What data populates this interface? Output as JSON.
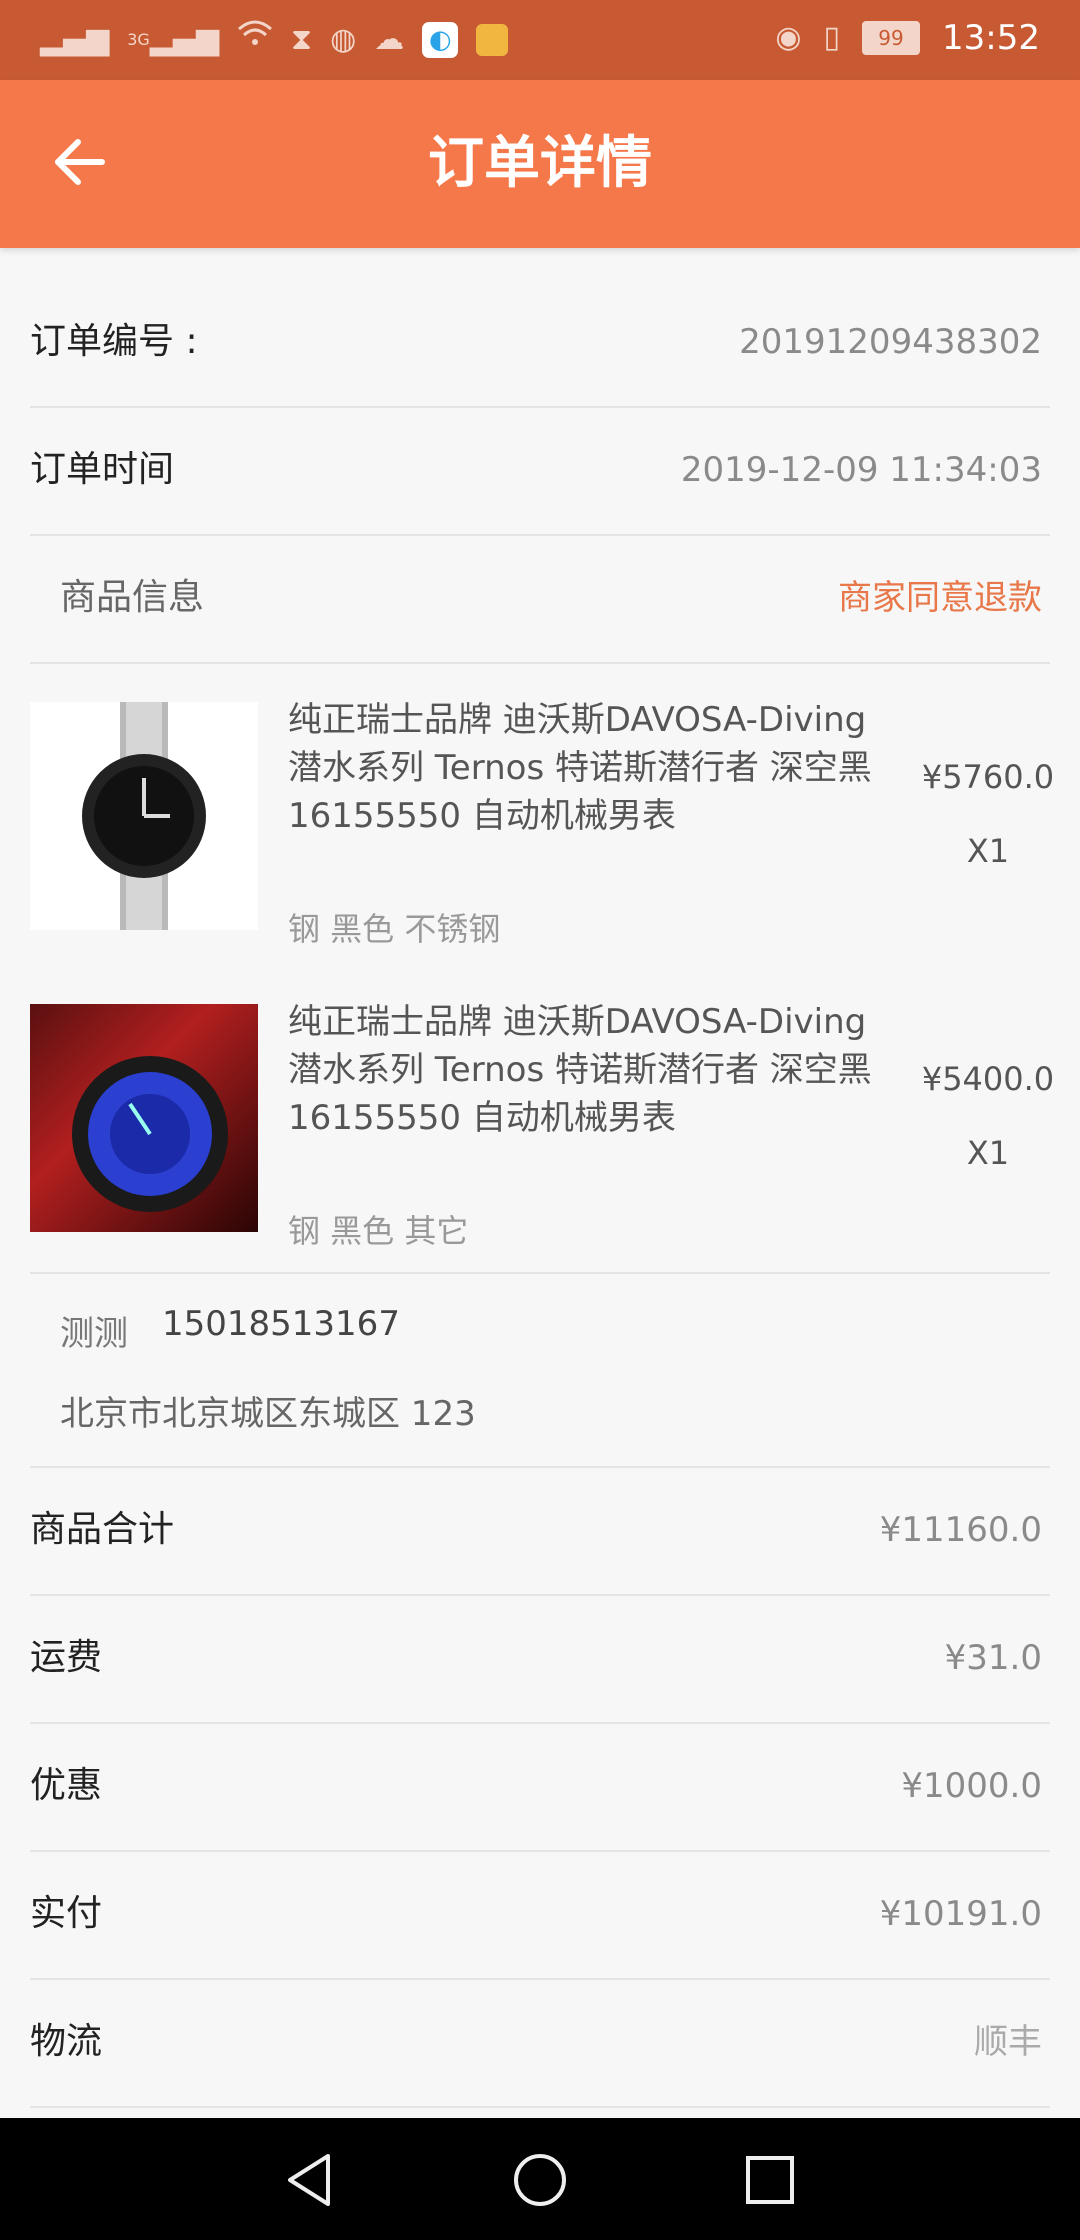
{
  "status_bar": {
    "time": "13:52",
    "battery": "99",
    "network": "3G",
    "left_icons": [
      "signal-icon",
      "signal-3g-icon",
      "wifi-icon",
      "hourglass-icon",
      "globe-icon",
      "cloud-icon",
      "app-browser-icon",
      "app-notification-icon"
    ],
    "right_icons": [
      "eye-icon",
      "vibrate-icon",
      "battery-icon"
    ]
  },
  "header": {
    "title": "订单详情",
    "back_icon": "arrow-left-icon"
  },
  "order": {
    "number_label": "订单编号 :",
    "number_value": "20191209438302",
    "time_label": "订单时间",
    "time_value": "2019-12-09 11:34:03"
  },
  "goods": {
    "section_label": "商品信息",
    "status": "商家同意退款",
    "items": [
      {
        "name": "纯正瑞士品牌 迪沃斯DAVOSA-Diving 潜水系列 Ternos 特诺斯潜行者 深空黑 16155550 自动机械男表",
        "spec": "钢 黑色 不锈钢",
        "price": "¥5760.0",
        "qty": "X1"
      },
      {
        "name": "纯正瑞士品牌 迪沃斯DAVOSA-Diving 潜水系列 Ternos 特诺斯潜行者 深空黑 16155550 自动机械男表",
        "spec": "钢 黑色 其它",
        "price": "¥5400.0",
        "qty": "X1"
      }
    ]
  },
  "address": {
    "name": "测测",
    "phone": "15018513167",
    "line": "北京市北京城区东城区 123"
  },
  "summary": {
    "subtotal_label": "商品合计",
    "subtotal_value": "¥11160.0",
    "shipping_label": "运费",
    "shipping_value": "¥31.0",
    "discount_label": "优惠",
    "discount_value": "¥1000.0",
    "paid_label": "实付",
    "paid_value": "¥10191.0",
    "logistics_label": "物流",
    "logistics_value": "顺丰"
  },
  "navbar": {
    "back": "nav-back-icon",
    "home": "nav-home-icon",
    "recents": "nav-recents-icon"
  },
  "colors": {
    "header": "#f5784a",
    "status_bar": "#c85a33",
    "accent_text": "#e8774a"
  }
}
